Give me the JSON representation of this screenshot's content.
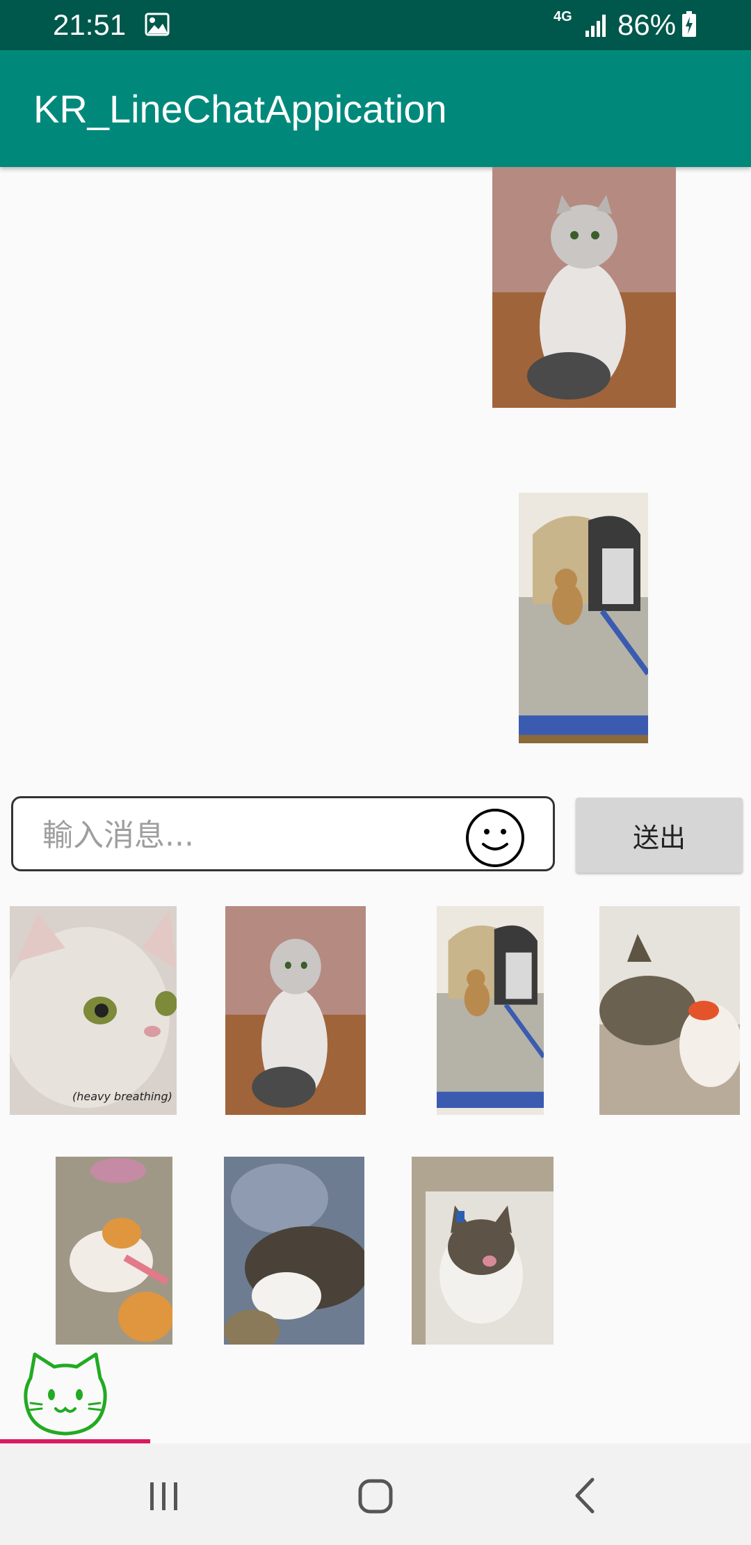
{
  "status_bar": {
    "time": "21:51",
    "network": "4G",
    "battery": "86%",
    "icons": [
      "gallery-icon",
      "signal-icon",
      "battery-charging-icon"
    ]
  },
  "app_bar": {
    "title": "KR_LineChatAppication"
  },
  "chat": {
    "messages": [
      {
        "type": "image",
        "subject": "fluffy grey-white cat sitting"
      },
      {
        "type": "image",
        "subject": "kitten next to pet carrier backpack"
      }
    ]
  },
  "composer": {
    "placeholder": "輸入消息...",
    "value": "",
    "emoji_icon": "smiley-face-icon",
    "send_label": "送出"
  },
  "sticker_panel": {
    "items": [
      {
        "subject": "cat close-up with caption",
        "caption": "(heavy breathing)"
      },
      {
        "subject": "fluffy grey-white cat sitting"
      },
      {
        "subject": "kitten next to pet carrier"
      },
      {
        "subject": "tabby cat with plush toy"
      },
      {
        "subject": "orange-white cat lying on carpet"
      },
      {
        "subject": "tabby cat sleeping on blanket"
      },
      {
        "subject": "cat looking up on rug"
      }
    ],
    "tab_icon": "cat-face-icon"
  },
  "nav_bar": {
    "icons": [
      "recent-apps-icon",
      "home-icon",
      "back-icon"
    ]
  },
  "colors": {
    "status_bar": "#00574b",
    "app_bar": "#00897b",
    "accent": "#d81b60",
    "sticker_green": "#22aa22"
  }
}
